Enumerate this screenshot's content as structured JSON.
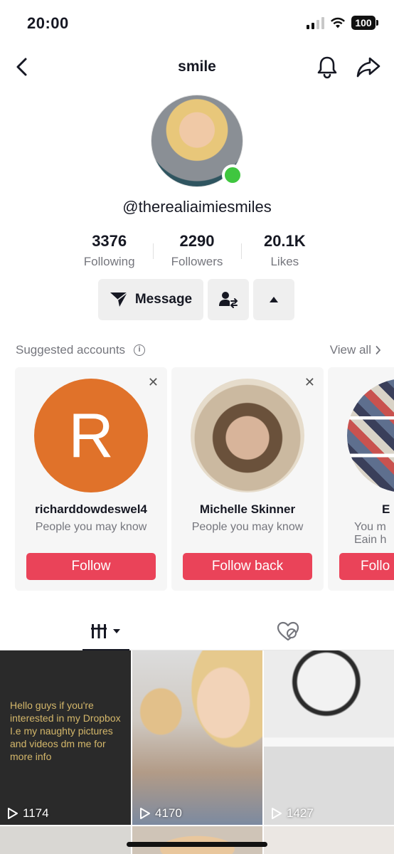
{
  "status_bar": {
    "time": "20:00",
    "battery": "100"
  },
  "header": {
    "title": "smile"
  },
  "profile": {
    "username": "@therealiaimiesmiles",
    "stats": [
      {
        "value": "3376",
        "label": "Following"
      },
      {
        "value": "2290",
        "label": "Followers"
      },
      {
        "value": "20.1K",
        "label": "Likes"
      }
    ],
    "message_label": "Message"
  },
  "suggested": {
    "title": "Suggested accounts",
    "view_all": "View all",
    "cards": [
      {
        "avatar_letter": "R",
        "name": "richarddowdeswel4",
        "subtitle": "People you may know",
        "button": "Follow"
      },
      {
        "name": "Michelle Skinner",
        "subtitle": "People you may know",
        "button": "Follow back"
      },
      {
        "name": "E",
        "subtitle": "You m\nEain h",
        "button": "Follo"
      }
    ]
  },
  "videos": [
    {
      "caption": "Hello guys if you're interested in my Dropbox I.e my naughty pictures and videos dm me for more info",
      "views": "1174"
    },
    {
      "views": "4170"
    },
    {
      "views": "1427"
    }
  ],
  "colors": {
    "accent": "#ea4359",
    "online": "#3fc63f",
    "avatar_r_bg": "#e0722a",
    "caption_gold": "#d4b76a"
  }
}
